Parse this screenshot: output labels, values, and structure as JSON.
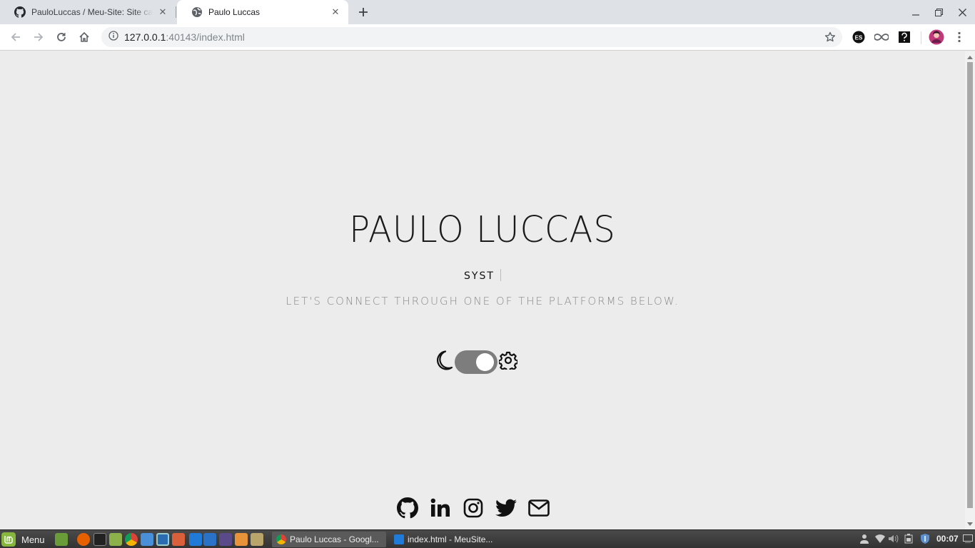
{
  "browser": {
    "tabs": [
      {
        "title": "PauloLuccas / Meu-Site: Site ca",
        "favicon": "github-icon"
      },
      {
        "title": "Paulo Luccas",
        "favicon": "globe-icon"
      }
    ],
    "url_host": "127.0.0.1",
    "url_rest": ":40143/index.html",
    "extensions": [
      "es-extension-icon",
      "infinity-extension-icon",
      "question-extension-icon"
    ]
  },
  "page": {
    "name": "PAULO LUCCAS",
    "typing_text": "SYST",
    "tagline": "LET'S CONNECT THROUGH ONE OF THE PLATFORMS BELOW.",
    "theme_toggle": {
      "left_icon": "moon-icon",
      "right_icon": "gear-icon",
      "state": "on"
    },
    "social": [
      "github-icon",
      "linkedin-icon",
      "instagram-icon",
      "twitter-icon",
      "email-icon"
    ]
  },
  "taskbar": {
    "menu_label": "Menu",
    "tasks": [
      {
        "label": "Paulo Luccas - Googl...",
        "active": true
      },
      {
        "label": "index.html - MeuSite...",
        "active": false
      }
    ],
    "clock": "00:07"
  },
  "colors": {
    "page_bg": "#ececec",
    "switch_track": "#7d7d7d",
    "tagline": "#8a8a8a"
  }
}
